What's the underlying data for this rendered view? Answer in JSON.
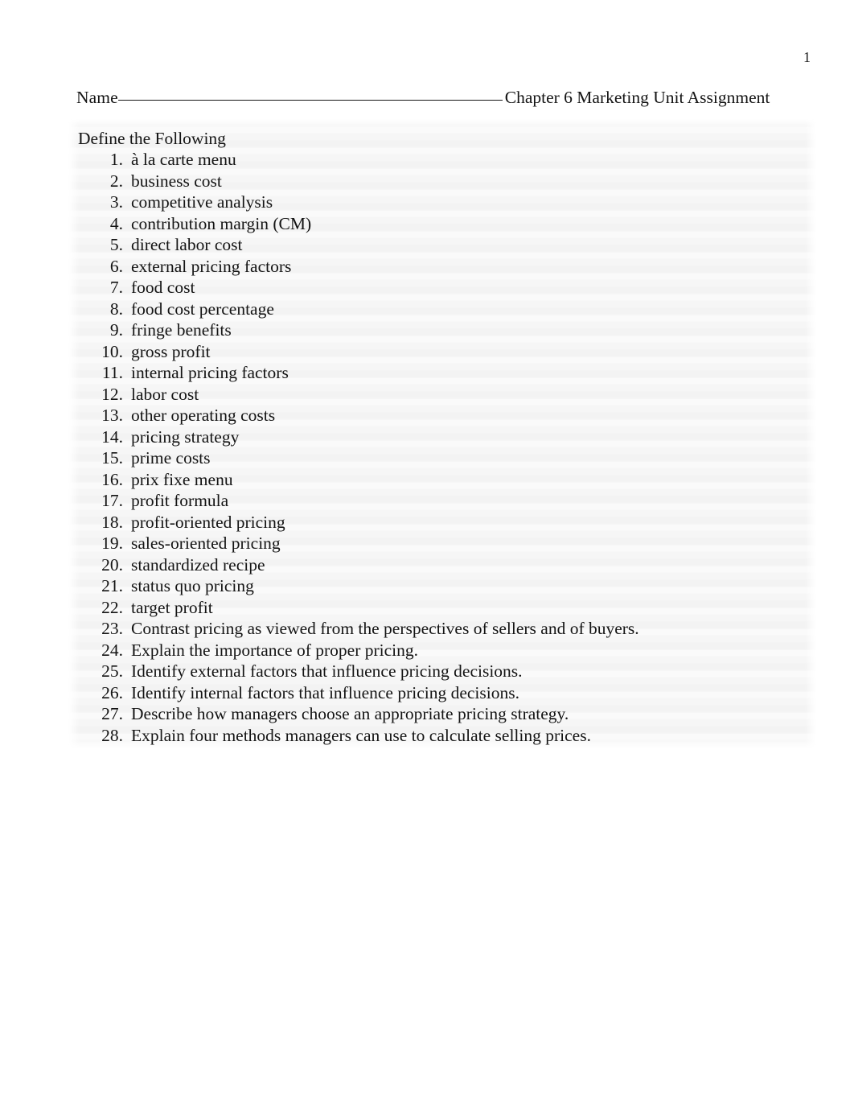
{
  "document": {
    "page_number": "1",
    "header": {
      "name_label": "Name",
      "name_blank": "________________________________________________",
      "assignment_title": "Chapter 6 Marketing Unit Assignment"
    },
    "section": {
      "heading": "Define the Following"
    },
    "items": [
      {
        "number": "1.",
        "text": "à la carte menu"
      },
      {
        "number": "2.",
        "text": "business cost"
      },
      {
        "number": "3.",
        "text": "competitive analysis"
      },
      {
        "number": "4.",
        "text": "contribution margin (CM)"
      },
      {
        "number": "5.",
        "text": "direct labor cost"
      },
      {
        "number": "6.",
        "text": "external pricing factors"
      },
      {
        "number": "7.",
        "text": "food cost"
      },
      {
        "number": "8.",
        "text": "food cost percentage"
      },
      {
        "number": "9.",
        "text": "fringe benefits"
      },
      {
        "number": "10.",
        "text": "gross profit"
      },
      {
        "number": "11.",
        "text": "internal pricing factors"
      },
      {
        "number": "12.",
        "text": "labor cost"
      },
      {
        "number": "13.",
        "text": "other operating costs"
      },
      {
        "number": "14.",
        "text": "pricing strategy"
      },
      {
        "number": "15.",
        "text": "prime costs"
      },
      {
        "number": "16.",
        "text": "prix fixe menu"
      },
      {
        "number": "17.",
        "text": "profit formula"
      },
      {
        "number": "18.",
        "text": "profit-oriented pricing"
      },
      {
        "number": "19.",
        "text": "sales-oriented pricing"
      },
      {
        "number": "20.",
        "text": "standardized recipe"
      },
      {
        "number": "21.",
        "text": "status quo pricing"
      },
      {
        "number": "22.",
        "text": "target profit"
      },
      {
        "number": "23.",
        "text": "Contrast pricing as viewed from the perspectives of sellers and of buyers."
      },
      {
        "number": "24.",
        "text": "Explain the importance of proper pricing."
      },
      {
        "number": "25.",
        "text": "Identify external factors that influence pricing decisions."
      },
      {
        "number": "26.",
        "text": "Identify internal factors that influence pricing decisions."
      },
      {
        "number": "27.",
        "text": "Describe how managers choose an appropriate pricing strategy."
      },
      {
        "number": "28.",
        "text": "Explain four methods managers can use to calculate selling prices."
      }
    ]
  },
  "colors": {
    "page_background": "#ffffff",
    "shaded_block": "#f4f4f4",
    "text": "#141414"
  }
}
